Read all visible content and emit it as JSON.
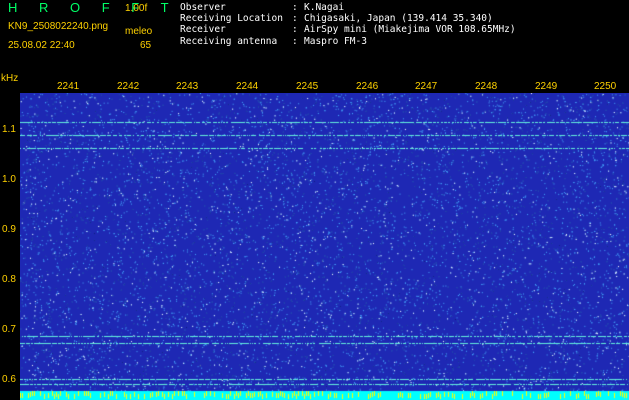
{
  "header": {
    "app_title": "H R O F F T",
    "version": "1.00f",
    "filename": "KN9_2508022240.png",
    "meleo_label": "meleo",
    "datetime": "25.08.02 22:40",
    "count": "65"
  },
  "meta": [
    {
      "key": "Observer",
      "sep": ":",
      "value": "K.Nagai"
    },
    {
      "key": "Receiving Location",
      "sep": ":",
      "value": "Chigasaki, Japan (139.414 35.340)"
    },
    {
      "key": "Receiver",
      "sep": ":",
      "value": "AirSpy mini (Miakejima VOR 108.65MHz)"
    },
    {
      "key": "Receiving antenna",
      "sep": ":",
      "value": "Maspro FM-3"
    }
  ],
  "chart_data": {
    "type": "heatmap",
    "ylabel": "kHz",
    "y_ticks": [
      "1.1",
      "1.0",
      "0.9",
      "0.8",
      "0.7",
      "0.6"
    ],
    "x_ticks": [
      "2241",
      "2242",
      "2243",
      "2244",
      "2245",
      "2246",
      "2247",
      "2248",
      "2249",
      "2250"
    ],
    "ylim": [
      0.58,
      1.17
    ],
    "colors": {
      "background": "#1e28b4",
      "noise": "#46aaff",
      "signal": "#64f0dc",
      "baseline": "#00ffff",
      "marker": "#ffff00"
    },
    "signals_khz": [
      1.115,
      1.09,
      1.065,
      0.703,
      0.69,
      0.62,
      0.61
    ]
  },
  "axis": {
    "unit": "kHz"
  }
}
